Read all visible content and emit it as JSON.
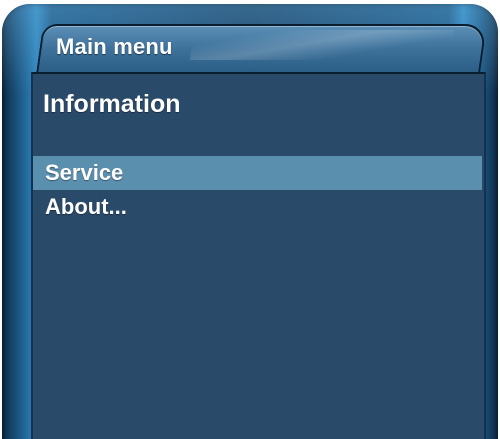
{
  "window": {
    "title": "Main menu"
  },
  "main": {
    "heading": "Information",
    "menu_items": [
      {
        "label": "Service",
        "selected": true
      },
      {
        "label": "About...",
        "selected": false
      }
    ]
  },
  "colors": {
    "panel_bg": "#2a4a6a",
    "selection_bg": "#5b8fae",
    "frame_accent": "#2f86bd",
    "text": "#ffffff"
  }
}
